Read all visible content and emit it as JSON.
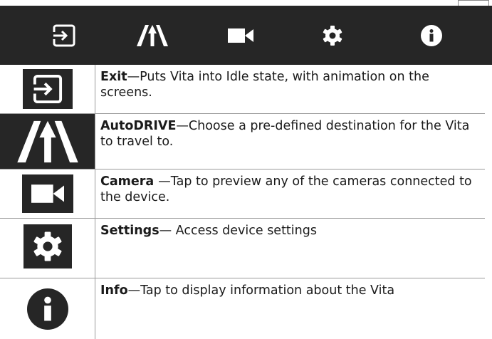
{
  "toolbar": {
    "buttons": [
      {
        "name": "exit",
        "icon": "exit-icon"
      },
      {
        "name": "autodrive",
        "icon": "road-icon"
      },
      {
        "name": "camera",
        "icon": "camera-icon"
      },
      {
        "name": "settings",
        "icon": "gear-icon"
      },
      {
        "name": "info",
        "icon": "info-icon"
      }
    ],
    "background": "#262626",
    "icon_color": "#ffffff"
  },
  "rows": [
    {
      "title": "Exit",
      "desc": "—Puts Vita into Idle state, with animation on the screens.",
      "icon": "exit-icon"
    },
    {
      "title": "AutoDRIVE",
      "desc": "—Choose a pre-defined destination for the Vita to travel to.",
      "icon": "road-icon"
    },
    {
      "title": "Camera ",
      "desc": "—Tap to preview any of the cameras connected to the device.",
      "icon": "camera-icon"
    },
    {
      "title": "Settings",
      "desc": "— Access device settings",
      "icon": "gear-icon"
    },
    {
      "title": "Info",
      "desc": "—Tap to display information about the Vita",
      "icon": "info-icon"
    }
  ]
}
